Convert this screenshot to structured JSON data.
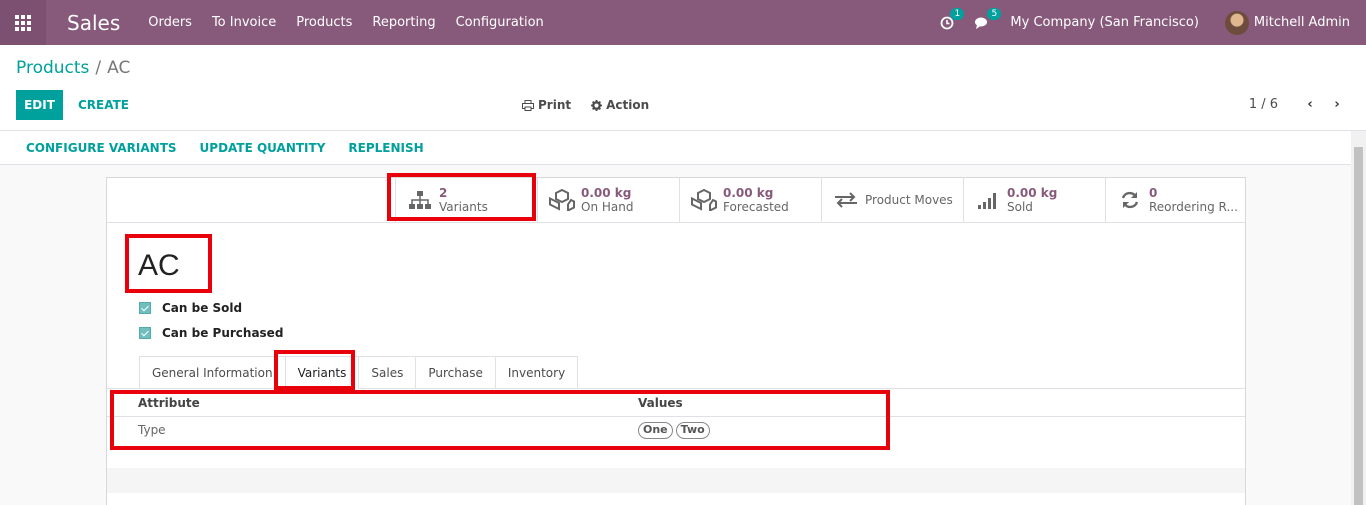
{
  "navbar": {
    "app_name": "Sales",
    "menu": [
      "Orders",
      "To Invoice",
      "Products",
      "Reporting",
      "Configuration"
    ],
    "activity_count": "1",
    "message_count": "5",
    "company": "My Company (San Francisco)",
    "user": "Mitchell Admin"
  },
  "breadcrumb": {
    "parent": "Products",
    "separator": "/",
    "current": "AC"
  },
  "buttons": {
    "edit": "EDIT",
    "create": "CREATE",
    "print": "Print",
    "action": "Action"
  },
  "pager": {
    "value": "1 / 6",
    "prev": "‹",
    "next": "›"
  },
  "statusbar": [
    "CONFIGURE VARIANTS",
    "UPDATE QUANTITY",
    "REPLENISH"
  ],
  "stats": [
    {
      "value": "2",
      "label": "Variants",
      "icon": "sitemap-icon"
    },
    {
      "value": "0.00 kg",
      "label": "On Hand",
      "icon": "cubes-icon"
    },
    {
      "value": "0.00 kg",
      "label": "Forecasted",
      "icon": "cubes-icon"
    },
    {
      "value": "",
      "label": "Product Moves",
      "icon": "exchange-icon"
    },
    {
      "value": "0.00 kg",
      "label": "Sold",
      "icon": "signal-icon"
    },
    {
      "value": "0",
      "label": "Reordering R...",
      "icon": "refresh-icon"
    }
  ],
  "product": {
    "name": "AC",
    "can_be_sold": "Can be Sold",
    "can_be_purchased": "Can be Purchased"
  },
  "tabs": [
    "General Information",
    "Variants",
    "Sales",
    "Purchase",
    "Inventory"
  ],
  "variants_table": {
    "columns": [
      "Attribute",
      "Values"
    ],
    "rows": [
      {
        "attribute": "Type",
        "values": [
          "One",
          "Two"
        ]
      }
    ]
  },
  "colors": {
    "navbar": "#875a7b",
    "accent": "#00a09d",
    "highlight": "#e8000b"
  }
}
